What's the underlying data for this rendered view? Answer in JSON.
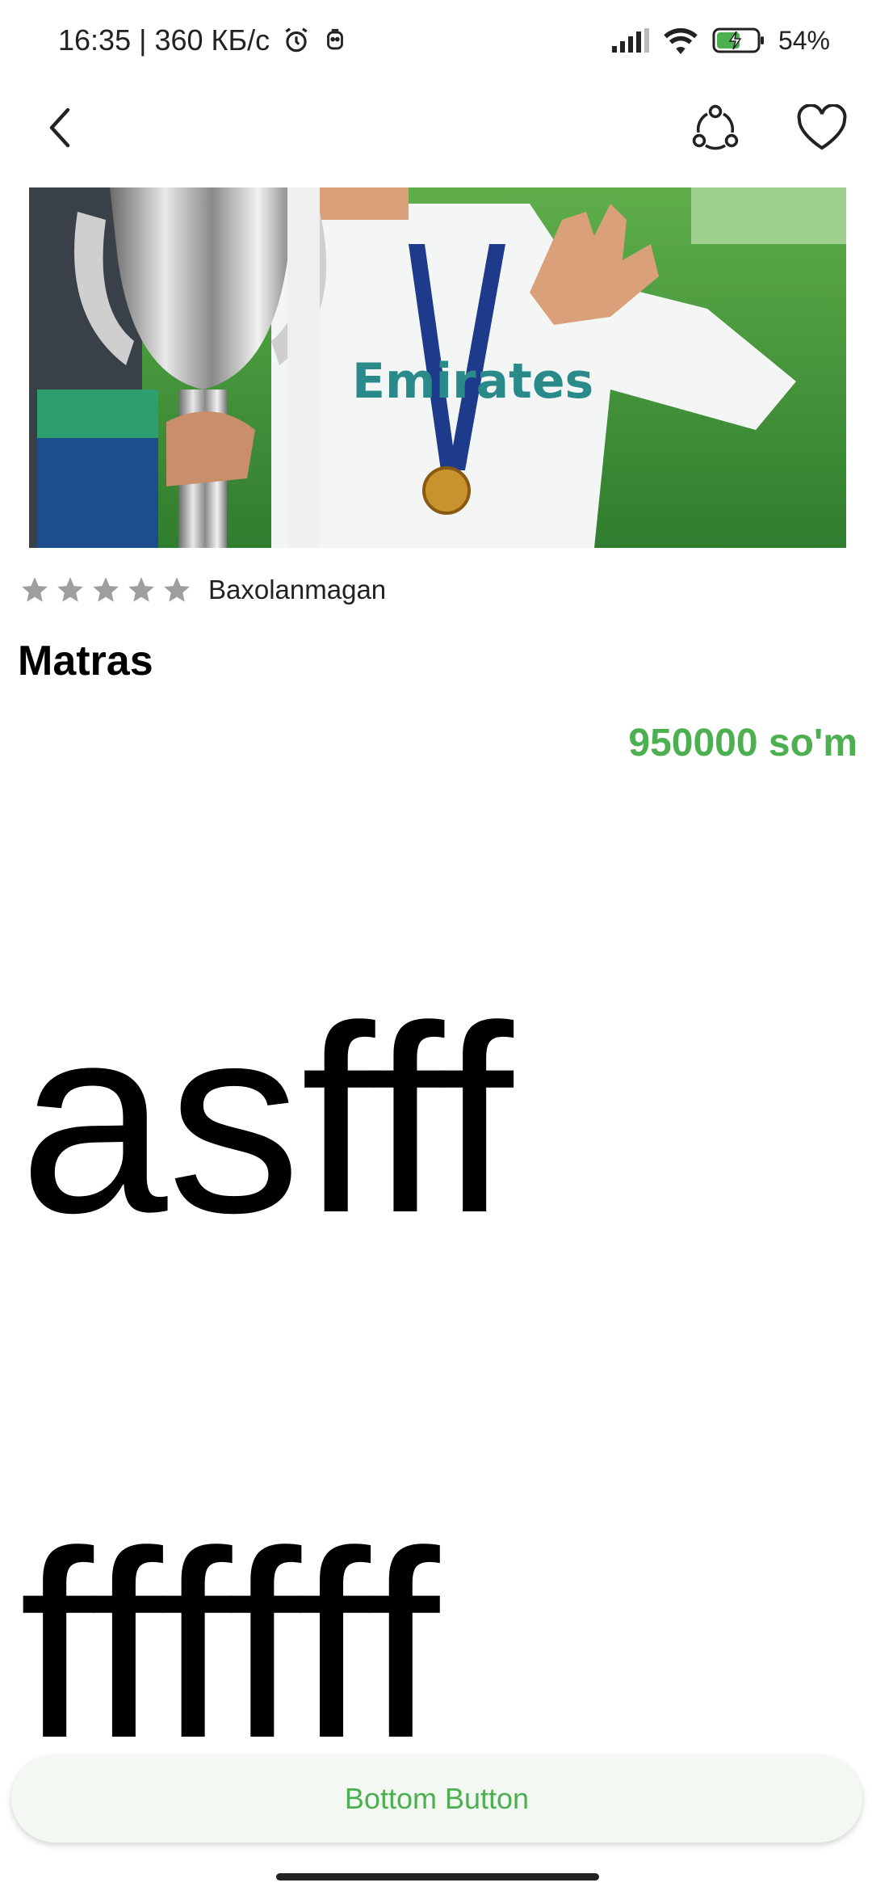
{
  "status_bar": {
    "time_speed": "16:35 | 360 КБ/с",
    "battery": "54%"
  },
  "toolbar": {
    "back_icon": "chevron-left-icon",
    "share_icon": "share-icon",
    "favorite_icon": "heart-outline-icon"
  },
  "product": {
    "image_alt": "product photo",
    "rating_value": 0,
    "rating_max": 5,
    "rating_label": "Baxolanmagan",
    "title": "Matras",
    "price": "950000 so'm",
    "description_lines": [
      "asfff",
      "ffffff"
    ]
  },
  "bottom_button": {
    "label": "Bottom Button"
  },
  "colors": {
    "accent": "#4caf50",
    "star_empty": "#9e9e9e",
    "button_bg": "#f3f8f3"
  }
}
